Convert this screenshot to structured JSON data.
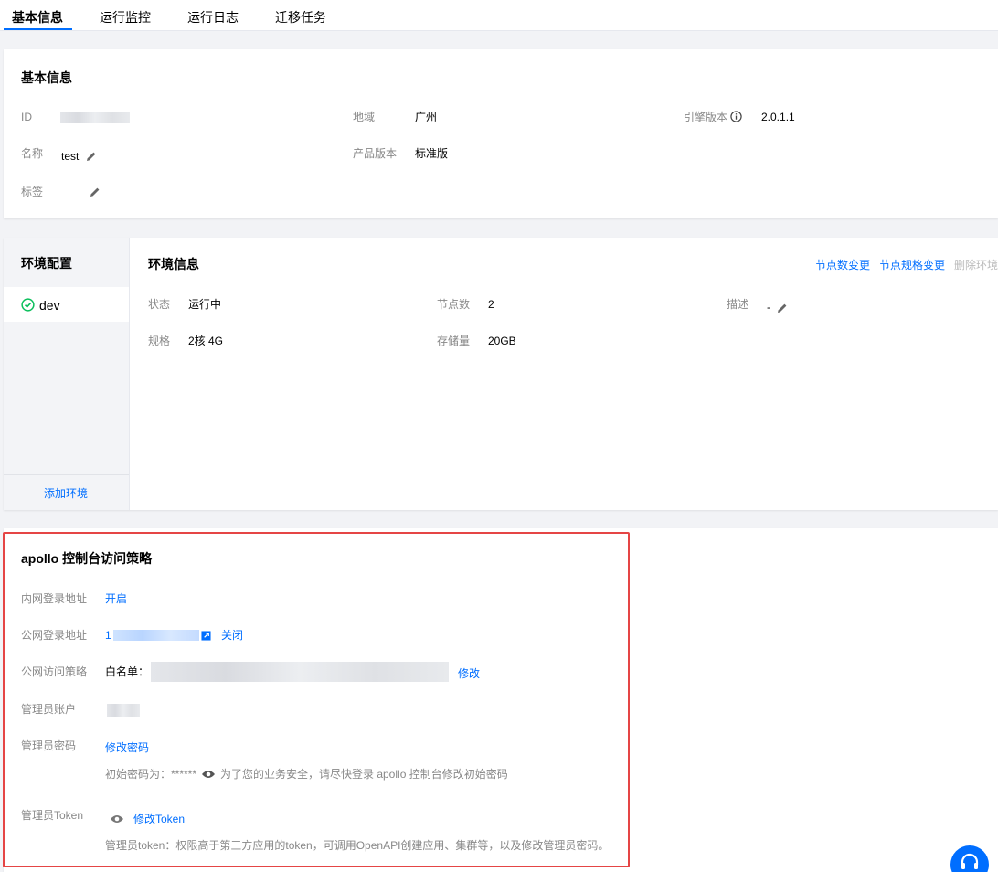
{
  "tabs": [
    {
      "label": "基本信息",
      "active": true
    },
    {
      "label": "运行监控"
    },
    {
      "label": "运行日志"
    },
    {
      "label": "迁移任务"
    }
  ],
  "basic": {
    "title": "基本信息",
    "id_label": "ID",
    "region_label": "地域",
    "region_value": "广州",
    "engine_label": "引擎版本",
    "engine_value": "2.0.1.1",
    "name_label": "名称",
    "name_value": "test",
    "edition_label": "产品版本",
    "edition_value": "标准版",
    "tags_label": "标签"
  },
  "env": {
    "sidebar_title": "环境配置",
    "env_name": "dev",
    "add_env": "添加环境",
    "info_title": "环境信息",
    "actions": {
      "node_count": "节点数变更",
      "node_spec": "节点规格变更",
      "delete": "删除环境"
    },
    "status_label": "状态",
    "status_value": "运行中",
    "nodes_label": "节点数",
    "nodes_value": "2",
    "desc_label": "描述",
    "desc_value": "-",
    "spec_label": "规格",
    "spec_value": "2核 4G",
    "storage_label": "存储量",
    "storage_value": "20GB"
  },
  "apollo": {
    "title": "apollo 控制台访问策略",
    "intranet_label": "内网登录地址",
    "intranet_action": "开启",
    "public_label": "公网登录地址",
    "public_value_prefix": "1",
    "public_action": "关闭",
    "policy_label": "公网访问策略",
    "policy_prefix": "白名单：",
    "policy_action": "修改",
    "admin_label": "管理员账户",
    "pwd_label": "管理员密码",
    "pwd_action": "修改密码",
    "pwd_hint_prefix": "初始密码为：******",
    "pwd_hint": "为了您的业务安全，请尽快登录 apollo 控制台修改初始密码",
    "token_label": "管理员Token",
    "token_action": "修改Token",
    "token_hint": "管理员token：权限高于第三方应用的token，可调用OpenAPI创建应用、集群等，以及修改管理员密码。"
  },
  "colors": {
    "accent": "#006eff",
    "success": "#0abf5b",
    "highlight_border": "#e54545"
  }
}
